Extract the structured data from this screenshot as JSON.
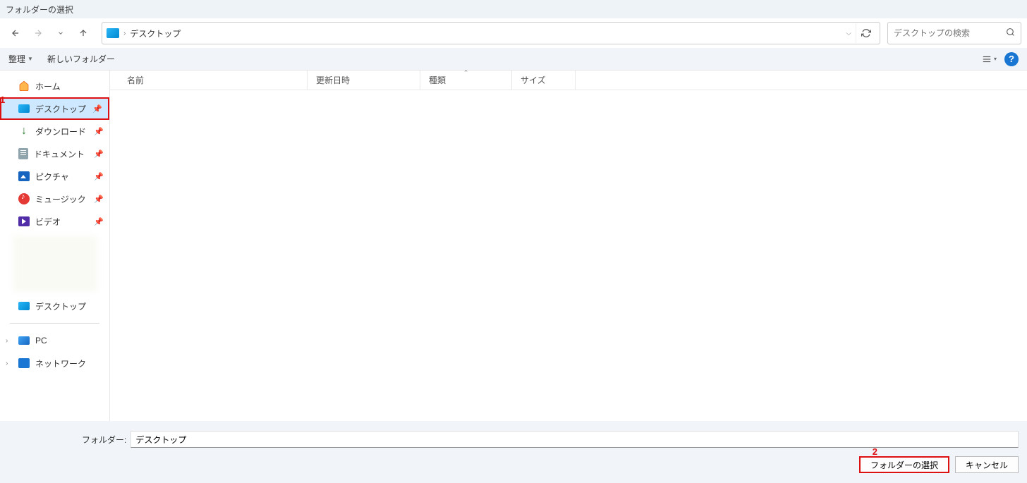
{
  "title": "フォルダーの選択",
  "nav": {
    "path_text": "デスクトップ",
    "search_placeholder": "デスクトップの検索"
  },
  "toolbar": {
    "organize": "整理",
    "new_folder": "新しいフォルダー"
  },
  "tree": {
    "home": "ホーム",
    "desktop": "デスクトップ",
    "downloads": "ダウンロード",
    "documents": "ドキュメント",
    "pictures": "ピクチャ",
    "music": "ミュージック",
    "video": "ビデオ",
    "desktop2": "デスクトップ",
    "pc": "PC",
    "network": "ネットワーク"
  },
  "columns": {
    "name": "名前",
    "date": "更新日時",
    "type": "種類",
    "size": "サイズ"
  },
  "footer": {
    "folder_label": "フォルダー:",
    "folder_value": "デスクトップ",
    "select_btn": "フォルダーの選択",
    "cancel_btn": "キャンセル"
  },
  "annotations": {
    "a1": "1",
    "a2": "2"
  }
}
